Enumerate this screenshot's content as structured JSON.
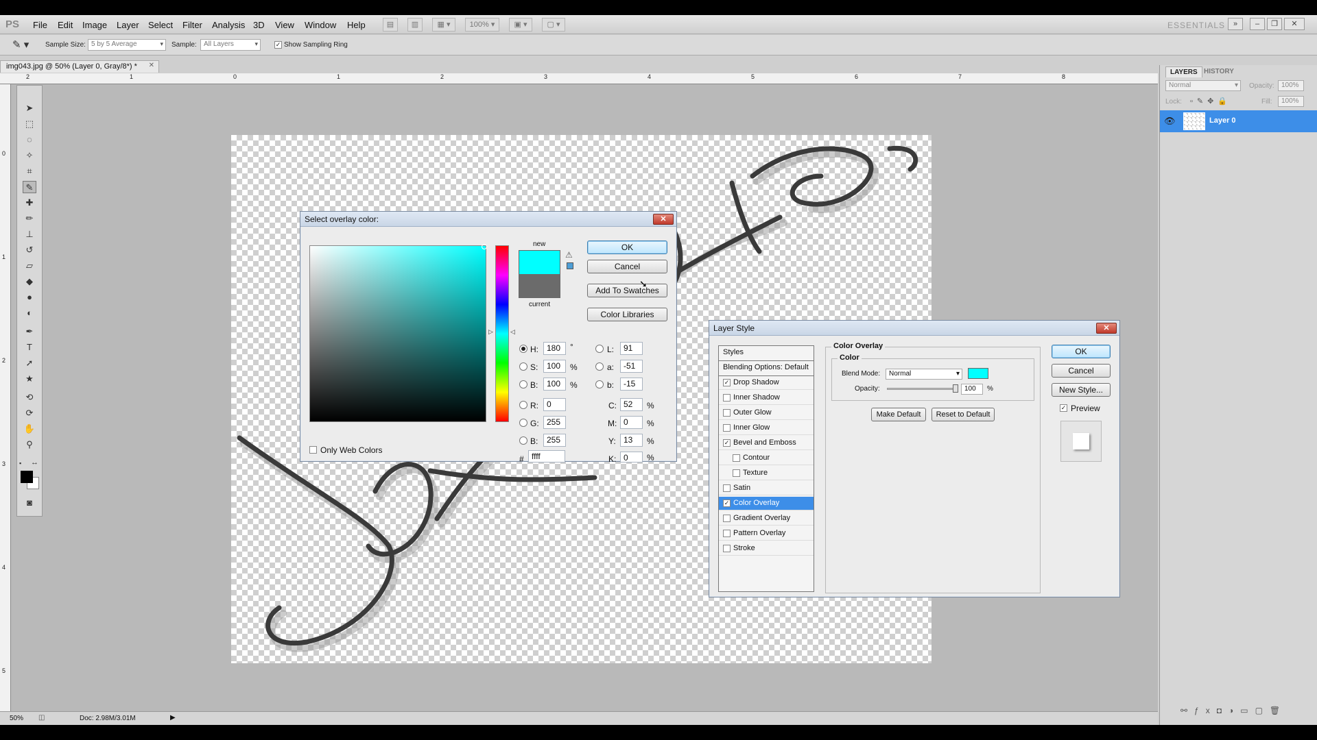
{
  "app": {
    "logo": "PS",
    "menu": [
      "File",
      "Edit",
      "Image",
      "Layer",
      "Select",
      "Filter",
      "Analysis",
      "3D",
      "View",
      "Window",
      "Help"
    ],
    "zoom_display": "100%",
    "workspace": "ESSENTIALS"
  },
  "options_bar": {
    "sample_size_label": "Sample Size:",
    "sample_size_value": "5 by 5 Average",
    "sample_label": "Sample:",
    "sample_value": "All Layers",
    "show_ring_label": "Show Sampling Ring"
  },
  "document": {
    "tab_title": "img043.jpg @ 50% (Layer 0, Gray/8*) *",
    "ruler_top": [
      "2",
      "1",
      "0",
      "1",
      "2",
      "3",
      "4",
      "5",
      "6",
      "7",
      "8"
    ],
    "ruler_left": [
      "0",
      "1",
      "2",
      "3",
      "4",
      "5"
    ]
  },
  "status": {
    "zoom": "50%",
    "doc_size": "Doc: 2.98M/3.01M"
  },
  "layers_panel": {
    "tabs": [
      "LAYERS",
      "HISTORY"
    ],
    "blend_mode": "Normal",
    "opacity_label": "Opacity:",
    "opacity_value": "100%",
    "lock_label": "Lock:",
    "fill_label": "Fill:",
    "fill_value": "100%",
    "layer_name": "Layer 0"
  },
  "color_picker": {
    "title": "Select overlay color:",
    "new_label": "new",
    "current_label": "current",
    "new_color": "#00ffff",
    "current_color": "#6b6b6b",
    "ok": "OK",
    "cancel": "Cancel",
    "add_swatches": "Add To Swatches",
    "color_libraries": "Color Libraries",
    "only_web_colors": "Only Web Colors",
    "H": "180",
    "H_unit": "°",
    "S": "100",
    "S_unit": "%",
    "Bv": "100",
    "B_unit": "%",
    "R": "0",
    "G": "255",
    "Bc": "255",
    "L": "91",
    "a": "-51",
    "b": "-15",
    "C": "52",
    "M": "0",
    "Y": "13",
    "K": "0",
    "pct": "%",
    "hex_label": "#",
    "hex": "ffff"
  },
  "layer_style": {
    "title": "Layer Style",
    "styles_header": "Styles",
    "blending_options": "Blending Options: Default",
    "items": [
      {
        "label": "Drop Shadow",
        "checked": "✓",
        "sub": false,
        "selected": false
      },
      {
        "label": "Inner Shadow",
        "checked": "",
        "sub": false,
        "selected": false
      },
      {
        "label": "Outer Glow",
        "checked": "",
        "sub": false,
        "selected": false
      },
      {
        "label": "Inner Glow",
        "checked": "",
        "sub": false,
        "selected": false
      },
      {
        "label": "Bevel and Emboss",
        "checked": "✓",
        "sub": false,
        "selected": false
      },
      {
        "label": "Contour",
        "checked": "",
        "sub": true,
        "selected": false
      },
      {
        "label": "Texture",
        "checked": "",
        "sub": true,
        "selected": false
      },
      {
        "label": "Satin",
        "checked": "",
        "sub": false,
        "selected": false
      },
      {
        "label": "Color Overlay",
        "checked": "✓",
        "sub": false,
        "selected": true
      },
      {
        "label": "Gradient Overlay",
        "checked": "",
        "sub": false,
        "selected": false
      },
      {
        "label": "Pattern Overlay",
        "checked": "",
        "sub": false,
        "selected": false
      },
      {
        "label": "Stroke",
        "checked": "",
        "sub": false,
        "selected": false
      }
    ],
    "section_title": "Color Overlay",
    "color_group": "Color",
    "blend_mode_label": "Blend Mode:",
    "blend_mode_value": "Normal",
    "overlay_color": "#00ffff",
    "opacity_label": "Opacity:",
    "opacity_value": "100",
    "opacity_unit": "%",
    "opacity_level": 1.0,
    "make_default": "Make Default",
    "reset_default": "Reset to Default",
    "ok": "OK",
    "cancel": "Cancel",
    "new_style": "New Style...",
    "preview_label": "Preview"
  }
}
